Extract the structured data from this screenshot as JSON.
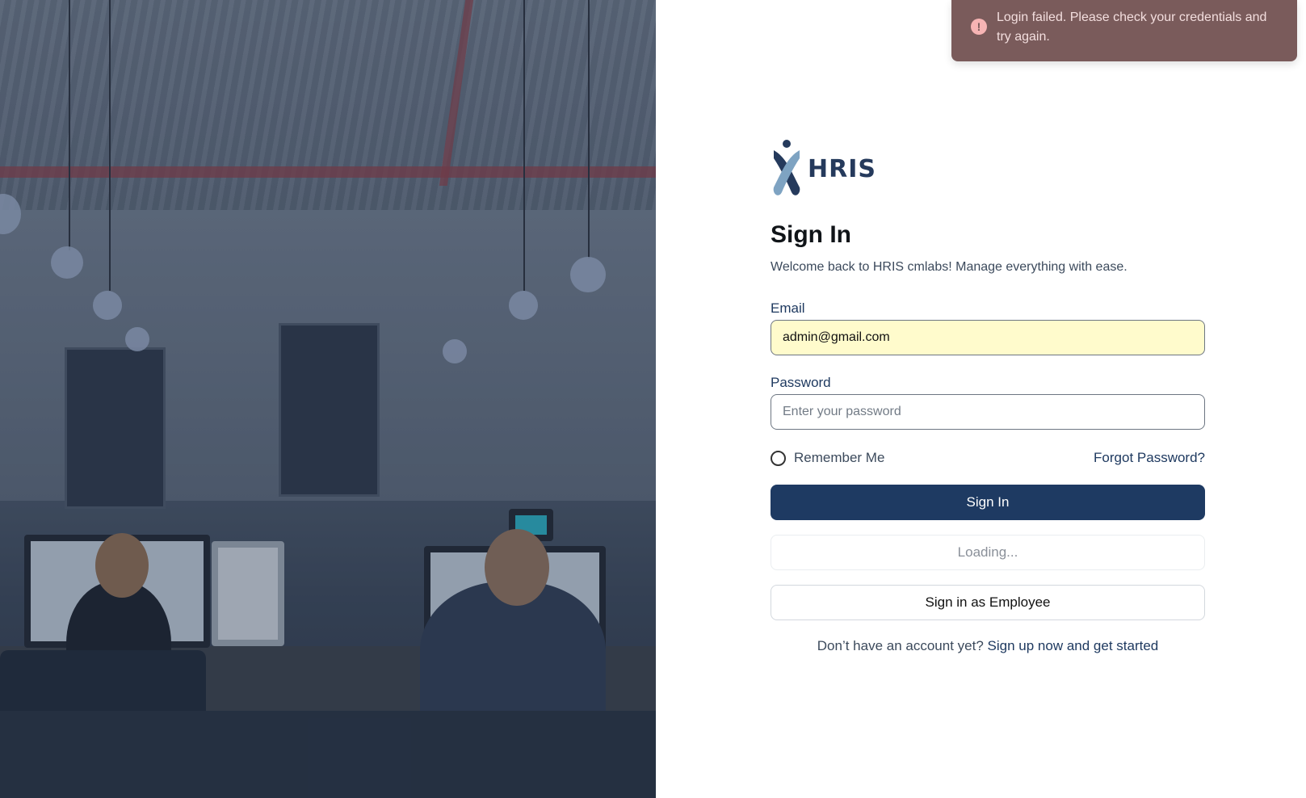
{
  "toast": {
    "message": "Login failed. Please check your credentials and try again.",
    "icon": "error-icon"
  },
  "brand": {
    "name": "HRIS",
    "primary_color": "#1e3a62"
  },
  "form": {
    "title": "Sign In",
    "subtitle": "Welcome back to HRIS cmlabs! Manage everything with ease.",
    "email_label": "Email",
    "email_value": "admin@gmail.com",
    "password_label": "Password",
    "password_placeholder": "Enter your password",
    "remember_label": "Remember Me",
    "forgot_label": "Forgot Password?",
    "sign_in_label": "Sign In",
    "loading_label": "Loading...",
    "employee_label": "Sign in as Employee",
    "signup_prompt": "Don’t have an account yet?",
    "signup_link": "Sign up now and get started"
  }
}
